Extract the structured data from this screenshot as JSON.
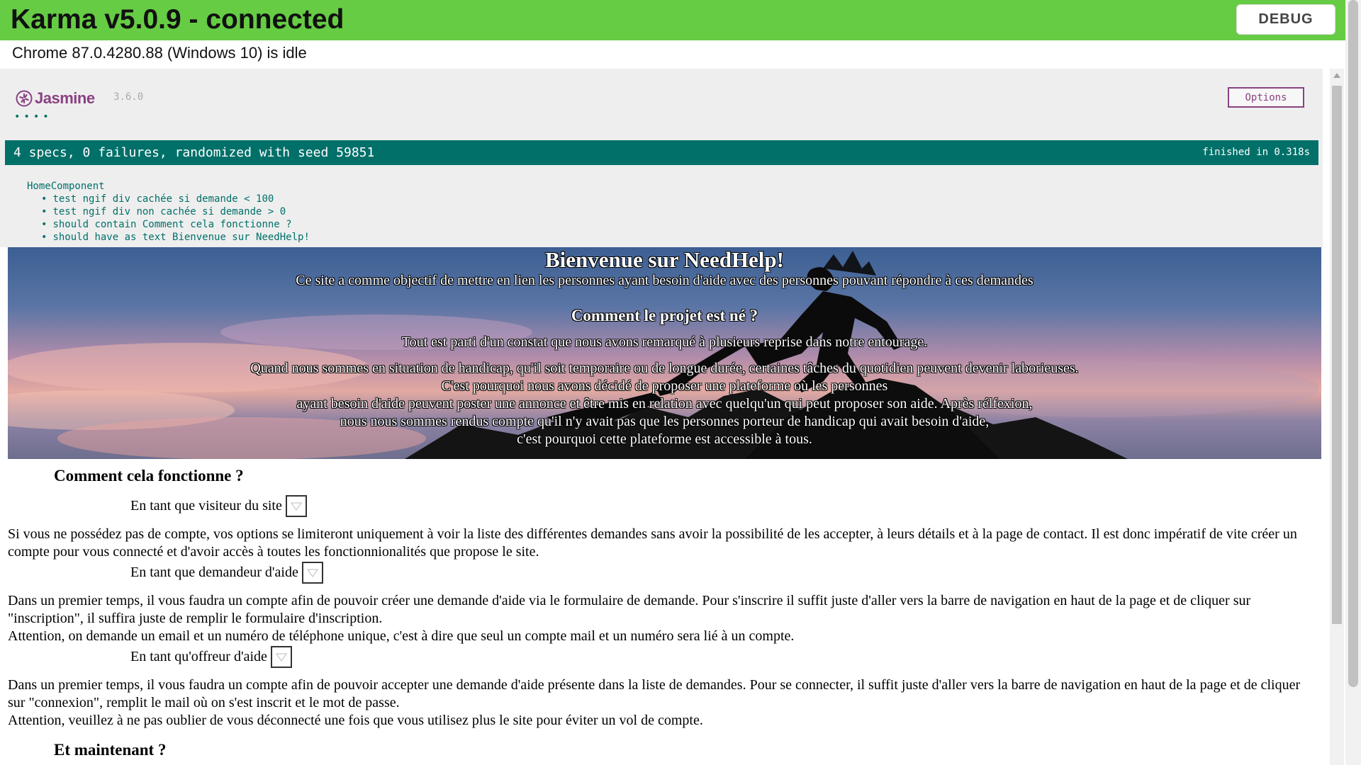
{
  "karma": {
    "title": "Karma v5.0.9 - connected",
    "debug_label": "DEBUG",
    "browser_status": "Chrome 87.0.4280.88 (Windows 10) is idle"
  },
  "jasmine": {
    "logo_text": "Jasmine",
    "version": "3.6.0",
    "dots": "••••",
    "options_label": "Options",
    "summary": "4 specs, 0 failures, randomized with seed 59851",
    "finished": "finished in 0.318s",
    "suite": "HomeComponent",
    "specs": [
      "test ngif div cachée si demande < 100",
      "test ngif div non cachée si demande > 0",
      "should contain Comment cela fonctionne ?",
      "should have as text Bienvenue sur NeedHelp!"
    ]
  },
  "hero": {
    "title": "Bienvenue sur NeedHelp!",
    "subtitle": "Ce site a comme objectif de mettre en lien les personnes ayant besoin d'aide avec des personnes pouvant répondre à ces demandes",
    "heading": "Comment le projet est né ?",
    "para1": "Tout est parti d'un constat que nous avons remarqué à plusieurs reprise dans notre entourage.",
    "para2_lines": [
      "Quand nous sommes en situation de handicap, qu'il soit temporaire ou de longue durée, certaines tâches du quotidien peuvent devenir laborieuses.",
      "C'est pourquoi nous avons décidé de proposer une plateforme où les personnes",
      "ayant besoin d'aide peuvent poster une annonce et être mis en relation avec quelqu'un qui peut proposer son aide. Après rélfexion,",
      "nous nous sommes rendus compte qu'il n'y avait pas que les personnes porteur de handicap qui avait besoin d'aide,",
      "c'est pourquoi cette plateforme est accessible à tous."
    ]
  },
  "how": {
    "title": "Comment cela fonctionne ?",
    "visitor_label": "En tant que visiteur du site",
    "visitor_text": "Si vous ne possédez pas de compte, vos options se limiteront uniquement à voir la liste des différentes demandes sans avoir la possibilité de les accepter, à leurs détails et à la page de contact. Il est donc impératif de vite créer un compte pour vous connecté et d'avoir accès à toutes les fonctionnionalités que propose le site.",
    "requester_label": "En tant que demandeur d'aide",
    "requester_text_1": "Dans un premier temps, il vous faudra un compte afin de pouvoir créer une demande d'aide via le formulaire de demande. Pour s'inscrire il suffit juste d'aller vers la barre de navigation en haut de la page et de cliquer sur \"inscription\", il suffira juste de remplir le formulaire d'inscription.",
    "requester_text_2": "Attention, on demande un email et un numéro de téléphone unique, c'est à dire que seul un compte mail et un numéro sera lié à un compte.",
    "helper_label": "En tant qu'offreur d'aide",
    "helper_text_1": "Dans un premier temps, il vous faudra un compte afin de pouvoir accepter une demande d'aide présente dans la liste de demandes. Pour se connecter, il suffit juste d'aller vers la barre de navigation en haut de la page et de cliquer sur \"connexion\", remplit le mail où on s'est inscrit et le mot de passe.",
    "helper_text_2": "Attention, veuillez à ne pas oublier de vous déconnecté une fois que vous utilisez plus le site pour éviter un vol de compte."
  },
  "next": {
    "title": "Et maintenant ?"
  },
  "colors": {
    "karma_green": "#66cc44",
    "jasmine_teal": "#007069",
    "jasmine_purple": "#8a4182"
  }
}
